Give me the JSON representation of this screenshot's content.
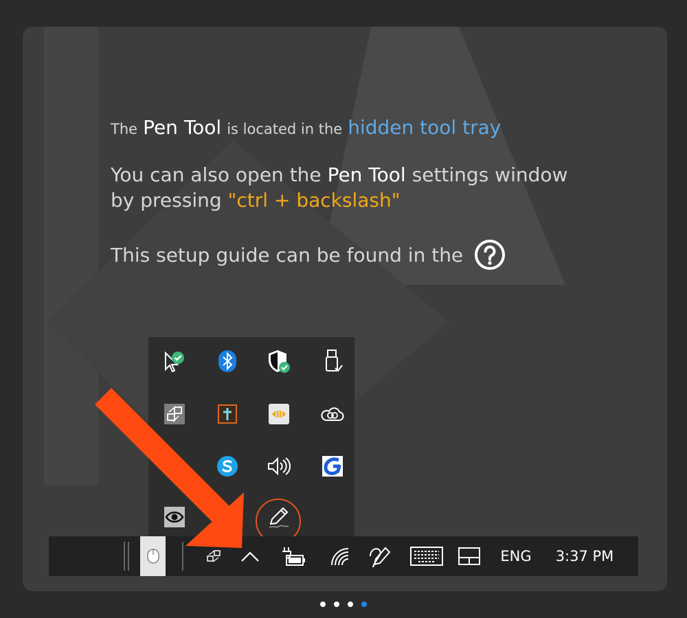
{
  "guide": {
    "line1_pre": "The",
    "line1_tool": "Pen Tool",
    "line1_mid": "is located in the",
    "line1_link": "hidden tool tray",
    "para2_pre": "You can also open the",
    "para2_tool": "Pen Tool",
    "para2_post": "settings window",
    "para2_line2_pre": "by pressing",
    "para2_shortcut": "\"ctrl + backslash\"",
    "para3": "This setup guide can be found in the"
  },
  "tray_icons": [
    "cursor-check-icon",
    "bluetooth-icon",
    "security-shield-icon",
    "usb-eject-icon",
    "display-switch-icon",
    "cross-app-icon",
    "audio-app-icon",
    "creative-cloud-icon",
    "skype-icon",
    "volume-icon",
    "g-app-icon",
    "eye-app-icon",
    "pen-tool-icon"
  ],
  "taskbar": {
    "language": "ENG",
    "time": "3:37 PM"
  },
  "pagination": {
    "total": 4,
    "active": 4
  },
  "colors": {
    "accent_link": "#5ea9e6",
    "shortcut": "#f0a818",
    "arrow": "#ff4a12",
    "pen_circle": "#e5541f",
    "active_dot": "#1e88e5"
  }
}
